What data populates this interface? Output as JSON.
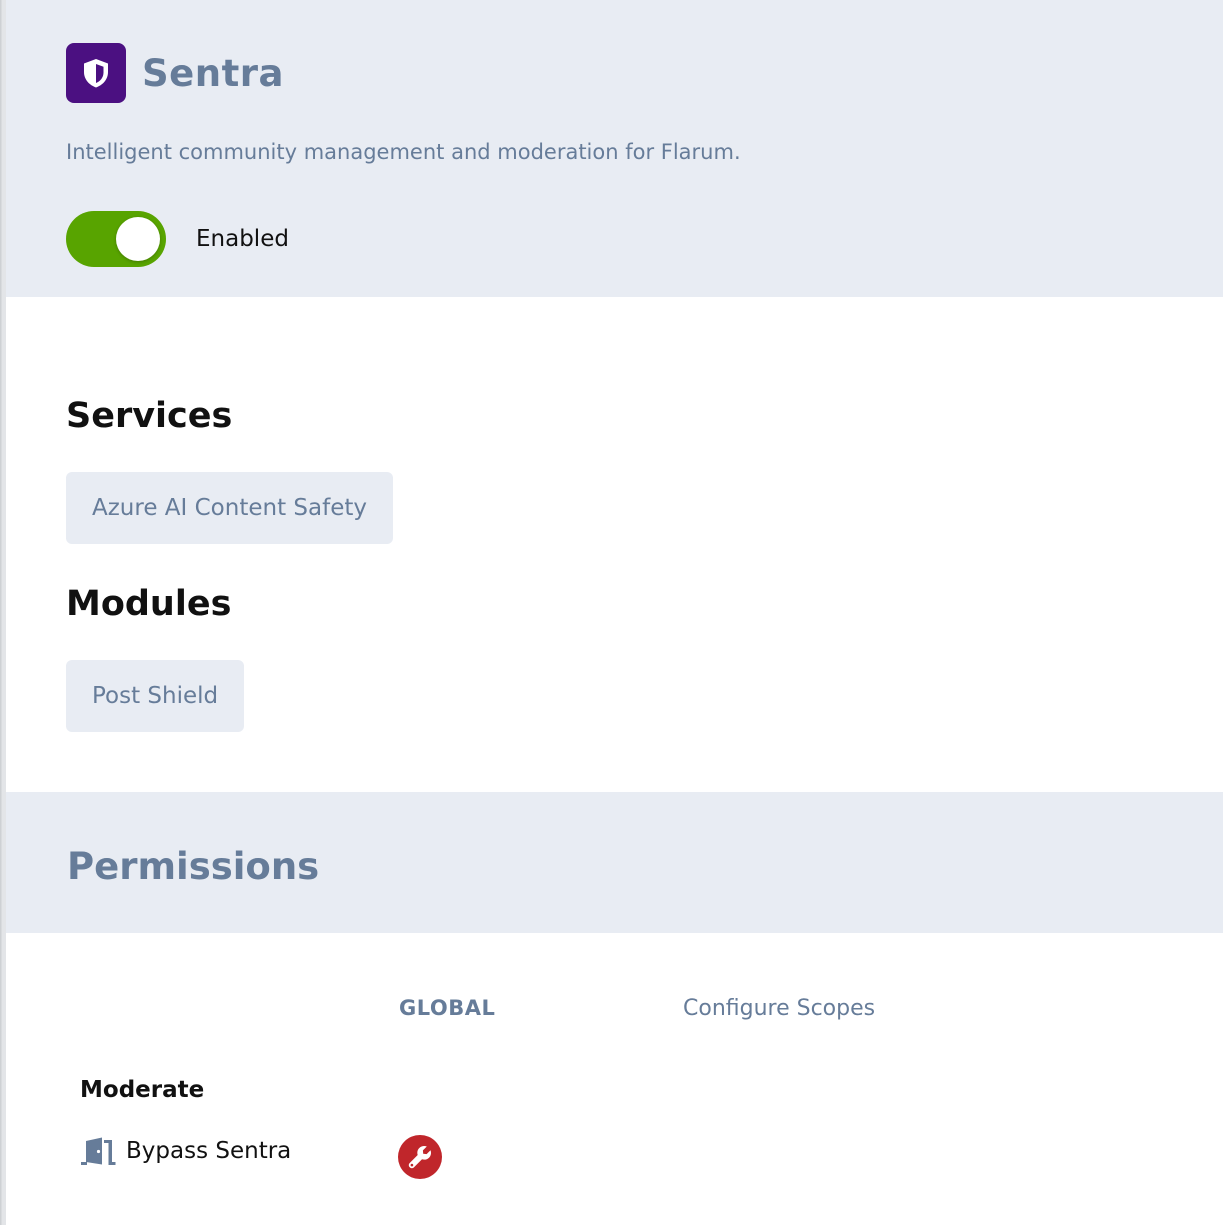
{
  "extension": {
    "title": "Sentra",
    "description": "Intelligent community management and moderation for Flarum.",
    "icon": "shield-icon",
    "icon_bg_color": "#4b1081",
    "enabled": true,
    "toggle_label": "Enabled",
    "toggle_color": "#58a400"
  },
  "services": {
    "heading": "Services",
    "items": [
      {
        "label": "Azure AI Content Safety"
      }
    ]
  },
  "modules": {
    "heading": "Modules",
    "items": [
      {
        "label": "Post Shield"
      }
    ]
  },
  "permissions": {
    "title": "Permissions",
    "columns": {
      "global": "GLOBAL",
      "configure_scopes": "Configure Scopes"
    },
    "groups": [
      {
        "label": "Moderate",
        "rows": [
          {
            "icon": "door-open-icon",
            "label": "Bypass Sentra",
            "setting_icon": "wrench-icon",
            "setting_color": "#c0262b"
          }
        ]
      }
    ]
  }
}
